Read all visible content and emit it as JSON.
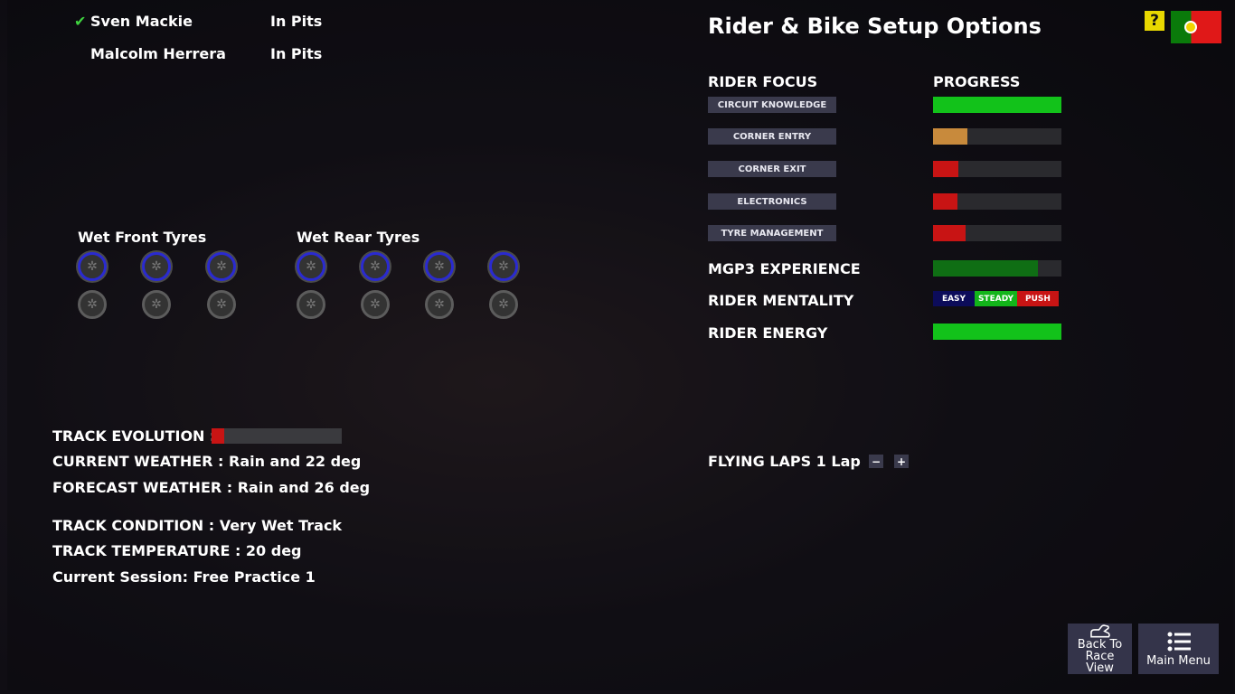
{
  "riders": [
    {
      "name": "Sven Mackie",
      "status": "In Pits",
      "selected": true,
      "check": "✔"
    },
    {
      "name": "Malcolm Herrera",
      "status": "In Pits",
      "selected": false
    }
  ],
  "tyres": {
    "front_label": "Wet Front Tyres",
    "rear_label": "Wet Rear Tyres",
    "front_new": 3,
    "front_used": 3,
    "rear_new": 4,
    "rear_used": 4
  },
  "conditions": {
    "track_evolution_label": "TRACK EVOLUTION :",
    "track_evolution_pct": 10,
    "current_weather": "CURRENT WEATHER : Rain and 22 deg",
    "forecast_weather": "FORECAST WEATHER : Rain and 26 deg",
    "track_condition": "TRACK CONDITION : Very Wet Track",
    "track_temperature": "TRACK TEMPERATURE : 20 deg",
    "session": "Current Session: Free Practice 1"
  },
  "setup": {
    "title": "Rider & Bike Setup Options",
    "help": "?",
    "rider_focus_label": "RIDER FOCUS",
    "progress_label": "PROGRESS",
    "focus": [
      {
        "label": "CIRCUIT KNOWLEDGE",
        "pct": 100,
        "color": "#12c21a"
      },
      {
        "label": "CORNER ENTRY",
        "pct": 27,
        "color": "#c88a3c"
      },
      {
        "label": "CORNER EXIT",
        "pct": 20,
        "color": "#c81414"
      },
      {
        "label": "ELECTRONICS",
        "pct": 19,
        "color": "#c81414"
      },
      {
        "label": "TYRE MANAGEMENT",
        "pct": 25,
        "color": "#c81414"
      }
    ],
    "experience_label": "MGP3 EXPERIENCE",
    "experience_pct": 82,
    "mentality_label": "RIDER MENTALITY",
    "mentality_options": [
      "EASY",
      "STEADY",
      "PUSH"
    ],
    "mentality_selected": "STEADY",
    "energy_label": "RIDER ENERGY",
    "energy_pct": 100,
    "flying_laps": "FLYING LAPS 1 Lap",
    "minus": "−",
    "plus": "+"
  },
  "nav": {
    "back": "Back To Race View",
    "menu": "Main Menu"
  }
}
